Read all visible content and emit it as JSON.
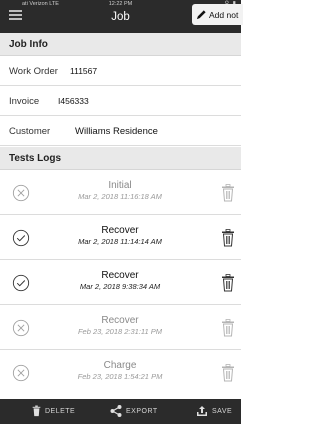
{
  "status_bar": {
    "carrier": "ati Verizon LTE",
    "time": "12:22 PM",
    "battery_glyphs": "⚲ ▮"
  },
  "header": {
    "title": "Job",
    "add_note_label": "Add not",
    "menu_icon": "hamburger-menu-icon",
    "pencil_icon": "pencil-icon"
  },
  "job_info": {
    "section_title": "Job Info",
    "fields": [
      {
        "label": "Work Order",
        "value": "111567"
      },
      {
        "label": "Invoice",
        "value": "I456333"
      },
      {
        "label": "Customer",
        "value": "Williams Residence"
      }
    ]
  },
  "tests_logs": {
    "section_title": "Tests Logs",
    "items": [
      {
        "type": "Initial",
        "date": "Mar 2, 2018 11:16:18 AM",
        "status": "failed",
        "status_icon": "circle-x-icon",
        "active": false
      },
      {
        "type": "Recover",
        "date": "Mar 2, 2018 11:14:14 AM",
        "status": "passed",
        "status_icon": "circle-check-icon",
        "active": true
      },
      {
        "type": "Recover",
        "date": "Mar 2, 2018 9:38:34 AM",
        "status": "passed",
        "status_icon": "circle-check-icon",
        "active": true
      },
      {
        "type": "Recover",
        "date": "Feb 23, 2018 2:31:11 PM",
        "status": "failed",
        "status_icon": "circle-x-icon",
        "active": false
      },
      {
        "type": "Charge",
        "date": "Feb 23, 2018 1:54:21 PM",
        "status": "failed",
        "status_icon": "circle-x-icon",
        "active": false
      }
    ]
  },
  "toolbar": {
    "delete_label": "DELETE",
    "export_label": "EXPORT",
    "save_label": "SAVE"
  },
  "colors": {
    "header_bg": "#2b2b2b",
    "section_bg": "#e9e9e9",
    "faded_text": "#8a8a8a"
  }
}
